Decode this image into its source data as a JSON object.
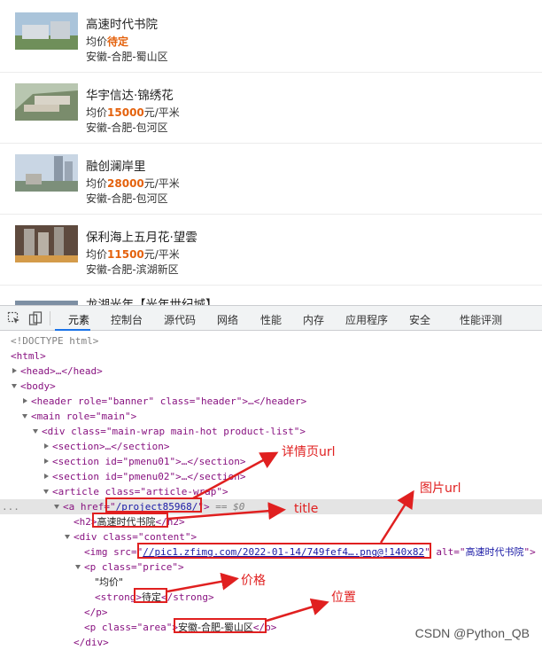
{
  "listings": [
    {
      "title": "高速时代书院",
      "price_prefix": "均价",
      "price_value": "待定",
      "price_suffix": "",
      "area": "安徽-合肥-蜀山区"
    },
    {
      "title": "华宇信达·锦绣花",
      "price_prefix": "均价",
      "price_value": "15000",
      "price_suffix": "元/平米",
      "area": "安徽-合肥-包河区"
    },
    {
      "title": "融创澜岸里",
      "price_prefix": "均价",
      "price_value": "28000",
      "price_suffix": "元/平米",
      "area": "安徽-合肥-包河区"
    },
    {
      "title": "保利海上五月花·望雲",
      "price_prefix": "均价",
      "price_value": "11500",
      "price_suffix": "元/平米",
      "area": "安徽-合肥-滨湖新区"
    },
    {
      "title": "龙湖光年【光年世纪城】",
      "price_prefix": "",
      "price_value": "",
      "price_suffix": "",
      "area": ""
    }
  ],
  "devtools": {
    "tabs": [
      "元素",
      "控制台",
      "源代码",
      "网络",
      "性能",
      "内存",
      "应用程序",
      "安全",
      "性能评测"
    ],
    "active_tab": "元素",
    "dom": {
      "doctype": "<!DOCTYPE html>",
      "html_open": "<html>",
      "head": "<head>…</head>",
      "body_open": "<body>",
      "header": "<header role=\"banner\" class=\"header\">…</header>",
      "main": "<main role=\"main\">",
      "div_wrap": "<div class=\"main-wrap main-hot product-list\">",
      "section1": "<section>…</section>",
      "section2": "<section id=\"pmenu01\">…</section>",
      "section3": "<section id=\"pmenu02\">…</section>",
      "article": "<article class=\"article-wrap\">",
      "a_open_prefix": "<a href=\"",
      "a_href": "/project85968/",
      "a_open_suffix": "\">",
      "a_eq": "== $0",
      "h2_prefix": "<h2>",
      "h2_text": "高速时代书院",
      "h2_suffix": "</h2>",
      "div_content": "<div class=\"content\">",
      "img_prefix": "<img src=\"",
      "img_src": "//pic1.zfimg.com/2022-01-14/749fef4….png@!140x82",
      "img_mid": "\" alt=\"",
      "img_alt": "高速时代书院",
      "img_suffix": "\">",
      "p_price": "<p class=\"price\">",
      "p_price_text": "\"均价\"",
      "strong_prefix": "<strong>",
      "strong_text": "待定",
      "strong_suffix": "</strong>",
      "p_close": "</p>",
      "p_area_prefix": "<p class=\"area\">",
      "p_area_text": "安徽-合肥-蜀山区",
      "p_area_suffix": "</p>",
      "div_close": "</div>"
    }
  },
  "annotations": {
    "detail_url": "详情页url",
    "title": "title",
    "image_url": "图片url",
    "price": "价格",
    "location": "位置"
  },
  "colors": {
    "annotation": "#e02020",
    "price_accent": "#e4620d",
    "tab_underline": "#1a73e8"
  },
  "watermark": "CSDN @Python_QB"
}
